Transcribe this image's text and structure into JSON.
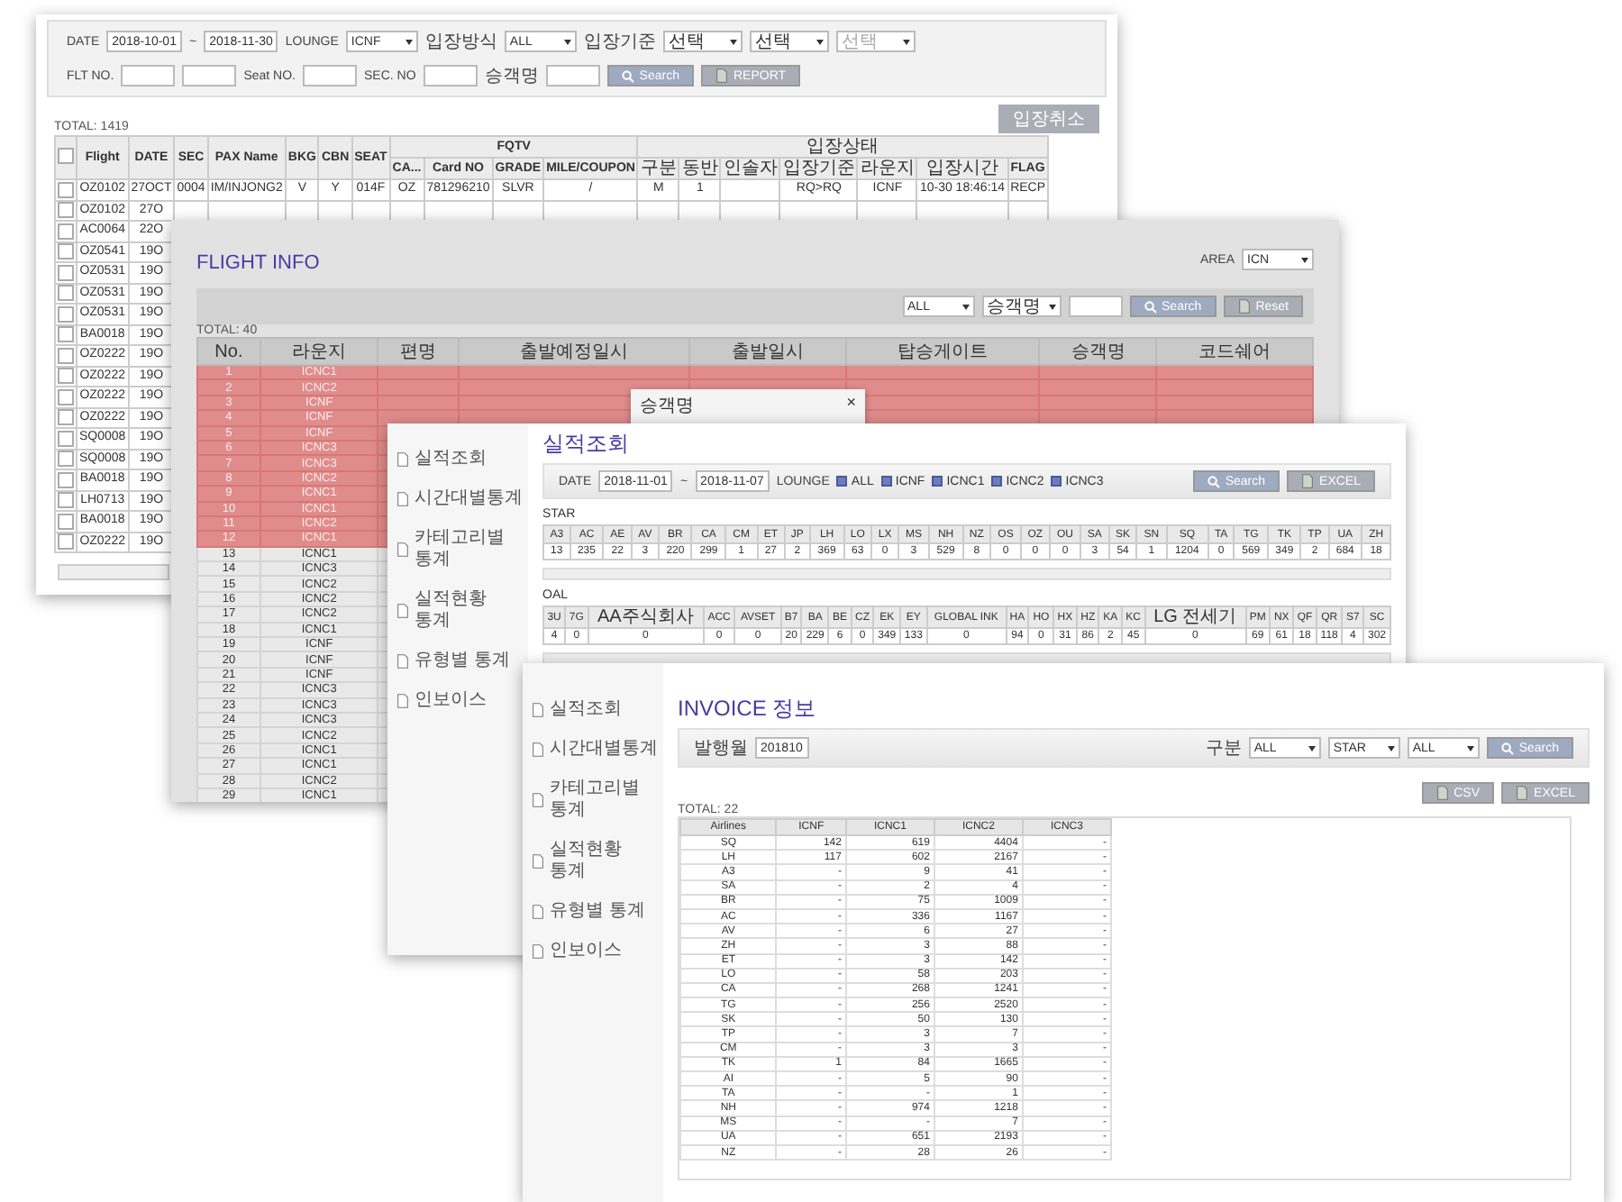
{
  "lounge_window": {
    "filter_rows": [
      {
        "items": [
          {
            "kind": "label",
            "text": "DATE"
          },
          {
            "kind": "input",
            "value": "2018-10-01"
          },
          {
            "kind": "label",
            "text": "~"
          },
          {
            "kind": "input",
            "value": "2018-11-30"
          },
          {
            "kind": "label",
            "text": "LOUNGE"
          },
          {
            "kind": "select",
            "value": "ICNF"
          },
          {
            "kind": "label",
            "text": "입장방식"
          },
          {
            "kind": "select",
            "value": "ALL"
          },
          {
            "kind": "label",
            "text": "입장기준"
          },
          {
            "kind": "select",
            "value": "선택",
            "disabled": false
          },
          {
            "kind": "select",
            "value": "선택",
            "disabled": false
          },
          {
            "kind": "select",
            "value": "선택",
            "disabled": true
          }
        ]
      },
      {
        "items": [
          {
            "kind": "label",
            "text": "FLT NO."
          },
          {
            "kind": "input"
          },
          {
            "kind": "input"
          },
          {
            "kind": "label",
            "text": "Seat NO."
          },
          {
            "kind": "input"
          },
          {
            "kind": "label",
            "text": "SEC. NO"
          },
          {
            "kind": "input"
          },
          {
            "kind": "label",
            "text": "승객명"
          },
          {
            "kind": "input"
          },
          {
            "kind": "search_button",
            "text": "Search"
          },
          {
            "kind": "file_button",
            "text": "REPORT"
          }
        ]
      }
    ],
    "total": "TOTAL: 1419",
    "cancel_button": "입장취소",
    "columns": [
      {
        "kind": "checkbox",
        "checked": false
      },
      {
        "label": "Flight"
      },
      {
        "label": "DATE"
      },
      {
        "label": "SEC"
      },
      {
        "label": "PAX Name"
      },
      {
        "label": "BKG"
      },
      {
        "label": "CBN"
      },
      {
        "label": "SEAT"
      },
      {
        "label": "FQTV",
        "colspan": 4,
        "children": [
          "CA...",
          "Card NO",
          "GRADE",
          "MILE/COUPON"
        ]
      },
      {
        "label": "입장상태",
        "colspan": 7,
        "children": [
          "구분",
          "동반",
          "인솔자",
          "입장기준",
          "라운지",
          "입장시간",
          "FLAG"
        ]
      }
    ],
    "rows": [
      {
        "cells": [
          {
            "checked": false
          },
          "OZ0102",
          "27OCT",
          "0004",
          "IM/INJONG2",
          "V",
          "Y",
          "014F",
          "OZ",
          "781296210",
          "SLVR",
          "/",
          "M",
          "1",
          null,
          "RQ>RQ",
          "ICNF",
          "10-30 18:46:14",
          "RECP"
        ]
      },
      {
        "cells": [
          {
            "checked": false
          },
          "OZ0102",
          "27O"
        ]
      },
      {
        "cells": [
          {
            "checked": false
          },
          "AC0064",
          "22O"
        ]
      },
      {
        "cells": [
          {
            "checked": false
          },
          "OZ0541",
          "19O"
        ]
      },
      {
        "cells": [
          {
            "checked": false
          },
          "OZ0531",
          "19O"
        ]
      },
      {
        "cells": [
          {
            "checked": false
          },
          "OZ0531",
          "19O"
        ]
      },
      {
        "cells": [
          {
            "checked": false
          },
          "OZ0531",
          "19O"
        ]
      },
      {
        "cells": [
          {
            "checked": false
          },
          "BA0018",
          "19O"
        ]
      },
      {
        "cells": [
          {
            "checked": false
          },
          "OZ0222",
          "19O"
        ]
      },
      {
        "cells": [
          {
            "checked": false
          },
          "OZ0222",
          "19O"
        ]
      },
      {
        "cells": [
          {
            "checked": false
          },
          "OZ0222",
          "19O"
        ]
      },
      {
        "cells": [
          {
            "checked": false
          },
          "OZ0222",
          "19O"
        ]
      },
      {
        "cells": [
          {
            "checked": false
          },
          "SQ0008",
          "19O"
        ]
      },
      {
        "cells": [
          {
            "checked": false
          },
          "SQ0008",
          "19O"
        ]
      },
      {
        "cells": [
          {
            "checked": false
          },
          "BA0018",
          "19O"
        ]
      },
      {
        "cells": [
          {
            "checked": false
          },
          "LH0713",
          "19O"
        ]
      },
      {
        "cells": [
          {
            "checked": false
          },
          "BA0018",
          "19O"
        ]
      },
      {
        "cells": [
          {
            "checked": false
          },
          "OZ0222",
          "19O"
        ]
      }
    ]
  },
  "flight_info_window": {
    "title": "FLIGHT INFO",
    "area_label": "AREA",
    "area_select": "ICN",
    "toolbar": [
      {
        "kind": "select",
        "value": "ALL"
      },
      {
        "kind": "select",
        "value": "승객명"
      },
      {
        "kind": "input"
      },
      {
        "kind": "search_button",
        "text": "Search"
      },
      {
        "kind": "file_button",
        "text": "Reset"
      }
    ],
    "total": "TOTAL: 40",
    "columns": [
      "No.",
      "라운지",
      "편명",
      "출발예정일시",
      "출발일시",
      "탑승게이트",
      "승객명",
      "코드쉐어"
    ],
    "rows": [
      {
        "no": "1",
        "lounge": "ICNC1",
        "highlighted": true
      },
      {
        "no": "2",
        "lounge": "ICNC2",
        "highlighted": true
      },
      {
        "no": "3",
        "lounge": "ICNF",
        "highlighted": true
      },
      {
        "no": "4",
        "lounge": "ICNF",
        "highlighted": true
      },
      {
        "no": "5",
        "lounge": "ICNF",
        "highlighted": true
      },
      {
        "no": "6",
        "lounge": "ICNC3",
        "highlighted": true
      },
      {
        "no": "7",
        "lounge": "ICNC3",
        "highlighted": true
      },
      {
        "no": "8",
        "lounge": "ICNC2",
        "highlighted": true
      },
      {
        "no": "9",
        "lounge": "ICNC1",
        "highlighted": true
      },
      {
        "no": "10",
        "lounge": "ICNC1",
        "highlighted": true
      },
      {
        "no": "11",
        "lounge": "ICNC2",
        "highlighted": true
      },
      {
        "no": "12",
        "lounge": "ICNC1",
        "highlighted": true
      },
      {
        "no": "13",
        "lounge": "ICNC1",
        "highlighted": false
      },
      {
        "no": "14",
        "lounge": "ICNC3",
        "highlighted": false
      },
      {
        "no": "15",
        "lounge": "ICNC2",
        "highlighted": false
      },
      {
        "no": "16",
        "lounge": "ICNC2",
        "highlighted": false
      },
      {
        "no": "17",
        "lounge": "ICNC2",
        "highlighted": false
      },
      {
        "no": "18",
        "lounge": "ICNC1",
        "highlighted": false
      },
      {
        "no": "19",
        "lounge": "ICNF",
        "highlighted": false
      },
      {
        "no": "20",
        "lounge": "ICNF",
        "highlighted": false
      },
      {
        "no": "21",
        "lounge": "ICNF",
        "highlighted": false
      },
      {
        "no": "22",
        "lounge": "ICNC3",
        "highlighted": false
      },
      {
        "no": "23",
        "lounge": "ICNC3",
        "highlighted": false
      },
      {
        "no": "24",
        "lounge": "ICNC3",
        "highlighted": false
      },
      {
        "no": "25",
        "lounge": "ICNC2",
        "highlighted": false
      },
      {
        "no": "26",
        "lounge": "ICNC1",
        "highlighted": false
      },
      {
        "no": "27",
        "lounge": "ICNC1",
        "highlighted": false
      },
      {
        "no": "28",
        "lounge": "ICNC2",
        "highlighted": false
      },
      {
        "no": "29",
        "lounge": "ICNC1",
        "highlighted": false
      }
    ]
  },
  "passenger_popup": {
    "title": "승객명",
    "close": "×"
  },
  "performance_window": {
    "sidebar": [
      "실적조회",
      "시간대별통계",
      "카테고리별 통계",
      "실적현황 통계",
      "유형별 통계",
      "인보이스"
    ],
    "title": "실적조회",
    "filters_left": [
      {
        "kind": "label",
        "text": "DATE"
      },
      {
        "kind": "input",
        "value": "2018-11-01"
      },
      {
        "kind": "label",
        "text": "~"
      },
      {
        "kind": "input",
        "value": "2018-11-07"
      },
      {
        "kind": "label",
        "text": "LOUNGE"
      },
      {
        "kind": "checkbox",
        "text": "ALL",
        "checked": true
      },
      {
        "kind": "checkbox",
        "text": "ICNF",
        "checked": true
      },
      {
        "kind": "checkbox",
        "text": "ICNC1",
        "checked": true
      },
      {
        "kind": "checkbox",
        "text": "ICNC2",
        "checked": true
      },
      {
        "kind": "checkbox",
        "text": "ICNC3",
        "checked": true
      }
    ],
    "filters_right": [
      {
        "kind": "search_button",
        "text": "Search"
      },
      {
        "kind": "file_button",
        "text": "EXCEL"
      }
    ],
    "tables": [
      {
        "caption": "STAR",
        "columns": [
          "A3",
          "AC",
          "AE",
          "AV",
          "BR",
          "CA",
          "CM",
          "ET",
          "JP",
          "LH",
          "LO",
          "LX",
          "MS",
          "NH",
          "NZ",
          "OS",
          "OZ",
          "OU",
          "SA",
          "SK",
          "SN",
          "SQ",
          "TA",
          "TG",
          "TK",
          "TP",
          "UA",
          "ZH"
        ],
        "values": [
          "13",
          "235",
          "22",
          "3",
          "220",
          "299",
          "1",
          "27",
          "2",
          "369",
          "63",
          "0",
          "3",
          "529",
          "8",
          "0",
          "0",
          "0",
          "3",
          "54",
          "1",
          "1204",
          "0",
          "569",
          "349",
          "2",
          "684",
          "18"
        ]
      },
      {
        "caption": "OAL",
        "columns": [
          "3U",
          "7G",
          "AA주식회사",
          "ACC",
          "AVSET",
          "B7",
          "BA",
          "BE",
          "CZ",
          "EK",
          "EY",
          "GLOBAL INK",
          "HA",
          "HO",
          "HX",
          "HZ",
          "KA",
          "KC",
          "LG 전세기",
          "PM",
          "NX",
          "QF",
          "QR",
          "S7",
          "SC"
        ],
        "values": [
          "4",
          "0",
          "0",
          "0",
          "0",
          "20",
          "229",
          "6",
          "0",
          "349",
          "133",
          "0",
          "94",
          "0",
          "31",
          "86",
          "2",
          "45",
          "0",
          "69",
          "61",
          "18",
          "118",
          "4",
          "302"
        ]
      }
    ]
  },
  "invoice_window": {
    "sidebar": [
      "실적조회",
      "시간대별통계",
      "카테고리별 통계",
      "실적현황 통계",
      "유형별 통계",
      "인보이스"
    ],
    "title": "INVOICE 정보",
    "filters_left": [
      {
        "kind": "label",
        "text": "발행월"
      },
      {
        "kind": "input",
        "value": "201810"
      }
    ],
    "filters_right": [
      {
        "kind": "label",
        "text": "구분"
      },
      {
        "kind": "select",
        "value": "ALL"
      },
      {
        "kind": "select",
        "value": "STAR"
      },
      {
        "kind": "select",
        "value": "ALL"
      },
      {
        "kind": "search_button",
        "text": "Search"
      }
    ],
    "buttons": [
      {
        "kind": "file_button",
        "text": "CSV"
      },
      {
        "kind": "file_button",
        "text": "EXCEL"
      }
    ],
    "total": "TOTAL: 22",
    "columns": [
      "Airlines",
      "ICNF",
      "ICNC1",
      "ICNC2",
      "ICNC3"
    ],
    "rows": [
      [
        "SQ",
        "142",
        "619",
        "4404",
        "-"
      ],
      [
        "LH",
        "117",
        "602",
        "2167",
        "-"
      ],
      [
        "A3",
        "-",
        "9",
        "41",
        "-"
      ],
      [
        "SA",
        "-",
        "2",
        "4",
        "-"
      ],
      [
        "BR",
        "-",
        "75",
        "1009",
        "-"
      ],
      [
        "AC",
        "-",
        "336",
        "1167",
        "-"
      ],
      [
        "AV",
        "-",
        "6",
        "27",
        "-"
      ],
      [
        "ZH",
        "-",
        "3",
        "88",
        "-"
      ],
      [
        "ET",
        "-",
        "3",
        "142",
        "-"
      ],
      [
        "LO",
        "-",
        "58",
        "203",
        "-"
      ],
      [
        "CA",
        "-",
        "268",
        "1241",
        "-"
      ],
      [
        "TG",
        "-",
        "256",
        "2520",
        "-"
      ],
      [
        "SK",
        "-",
        "50",
        "130",
        "-"
      ],
      [
        "TP",
        "-",
        "3",
        "7",
        "-"
      ],
      [
        "CM",
        "-",
        "3",
        "3",
        "-"
      ],
      [
        "TK",
        "1",
        "84",
        "1665",
        "-"
      ],
      [
        "AI",
        "-",
        "5",
        "90",
        "-"
      ],
      [
        "TA",
        "-",
        "-",
        "1",
        "-"
      ],
      [
        "NH",
        "-",
        "974",
        "1218",
        "-"
      ],
      [
        "MS",
        "-",
        "-",
        "7",
        "-"
      ],
      [
        "UA",
        "-",
        "651",
        "2193",
        "-"
      ],
      [
        "NZ",
        "-",
        "28",
        "26",
        "-"
      ]
    ]
  }
}
